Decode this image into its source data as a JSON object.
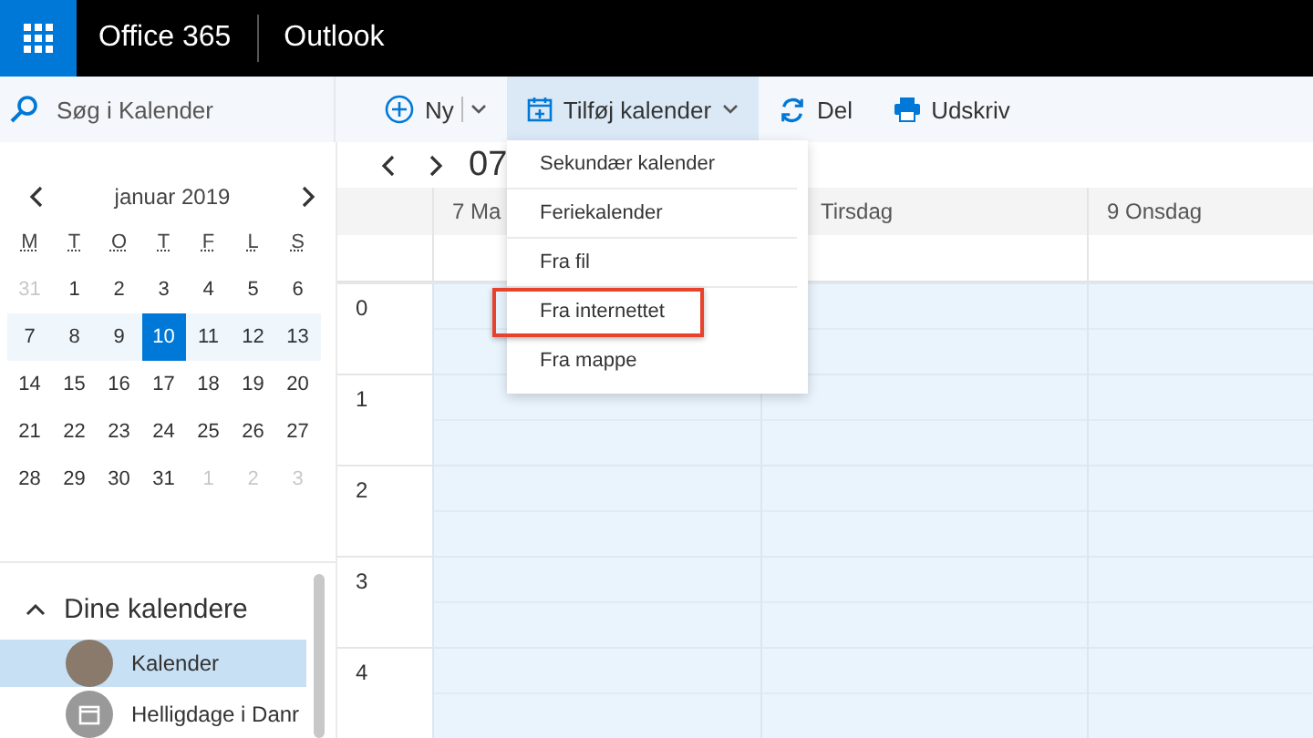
{
  "app_bar": {
    "suite": "Office 365",
    "app": "Outlook"
  },
  "search": {
    "placeholder": "Søg i Kalender"
  },
  "toolbar": [
    {
      "kind": "new",
      "label": "Ny",
      "selected": false
    },
    {
      "kind": "add",
      "label": "Tilføj kalender",
      "selected": true
    },
    {
      "kind": "share",
      "label": "Del",
      "selected": false
    },
    {
      "kind": "print",
      "label": "Udskriv",
      "selected": false
    }
  ],
  "mini_calendar": {
    "month": "januar 2019",
    "weekdays": [
      "M",
      "T",
      "O",
      "T",
      "F",
      "L",
      "S"
    ],
    "weeks": [
      {
        "highlighted": false,
        "days": [
          {
            "label": "31",
            "muted": true,
            "selected": false
          },
          {
            "label": "1",
            "muted": false,
            "selected": false
          },
          {
            "label": "2",
            "muted": false,
            "selected": false
          },
          {
            "label": "3",
            "muted": false,
            "selected": false
          },
          {
            "label": "4",
            "muted": false,
            "selected": false
          },
          {
            "label": "5",
            "muted": false,
            "selected": false
          },
          {
            "label": "6",
            "muted": false,
            "selected": false
          }
        ]
      },
      {
        "highlighted": true,
        "days": [
          {
            "label": "7",
            "muted": false,
            "selected": false
          },
          {
            "label": "8",
            "muted": false,
            "selected": false
          },
          {
            "label": "9",
            "muted": false,
            "selected": false
          },
          {
            "label": "10",
            "muted": false,
            "selected": true
          },
          {
            "label": "11",
            "muted": false,
            "selected": false
          },
          {
            "label": "12",
            "muted": false,
            "selected": false
          },
          {
            "label": "13",
            "muted": false,
            "selected": false
          }
        ]
      },
      {
        "highlighted": false,
        "days": [
          {
            "label": "14",
            "muted": false,
            "selected": false
          },
          {
            "label": "15",
            "muted": false,
            "selected": false
          },
          {
            "label": "16",
            "muted": false,
            "selected": false
          },
          {
            "label": "17",
            "muted": false,
            "selected": false
          },
          {
            "label": "18",
            "muted": false,
            "selected": false
          },
          {
            "label": "19",
            "muted": false,
            "selected": false
          },
          {
            "label": "20",
            "muted": false,
            "selected": false
          }
        ]
      },
      {
        "highlighted": false,
        "days": [
          {
            "label": "21",
            "muted": false,
            "selected": false
          },
          {
            "label": "22",
            "muted": false,
            "selected": false
          },
          {
            "label": "23",
            "muted": false,
            "selected": false
          },
          {
            "label": "24",
            "muted": false,
            "selected": false
          },
          {
            "label": "25",
            "muted": false,
            "selected": false
          },
          {
            "label": "26",
            "muted": false,
            "selected": false
          },
          {
            "label": "27",
            "muted": false,
            "selected": false
          }
        ]
      },
      {
        "highlighted": false,
        "days": [
          {
            "label": "28",
            "muted": false,
            "selected": false
          },
          {
            "label": "29",
            "muted": false,
            "selected": false
          },
          {
            "label": "30",
            "muted": false,
            "selected": false
          },
          {
            "label": "31",
            "muted": false,
            "selected": false
          },
          {
            "label": "1",
            "muted": true,
            "selected": false
          },
          {
            "label": "2",
            "muted": true,
            "selected": false
          },
          {
            "label": "3",
            "muted": true,
            "selected": false
          }
        ]
      }
    ]
  },
  "calendars": {
    "heading": "Dine kalendere",
    "expanded": true,
    "items": [
      {
        "kind": "avatar",
        "name": "Kalender",
        "selected": true
      },
      {
        "kind": "calendar",
        "name": "Helligdage i Danr",
        "selected": false
      }
    ]
  },
  "view": {
    "title": "07",
    "days": [
      "7 Ma",
      "Tirsdag",
      "9 Onsdag"
    ],
    "hours": [
      "0",
      "1",
      "2",
      "3",
      "4"
    ]
  },
  "dropdown": {
    "items": [
      {
        "label": "Sekundær kalender",
        "highlighted": false
      },
      {
        "label": "Feriekalender",
        "highlighted": false
      },
      {
        "label": "Fra fil",
        "highlighted": false
      },
      {
        "label": "Fra internettet",
        "highlighted": true
      },
      {
        "label": "Fra mappe",
        "highlighted": false
      }
    ]
  }
}
